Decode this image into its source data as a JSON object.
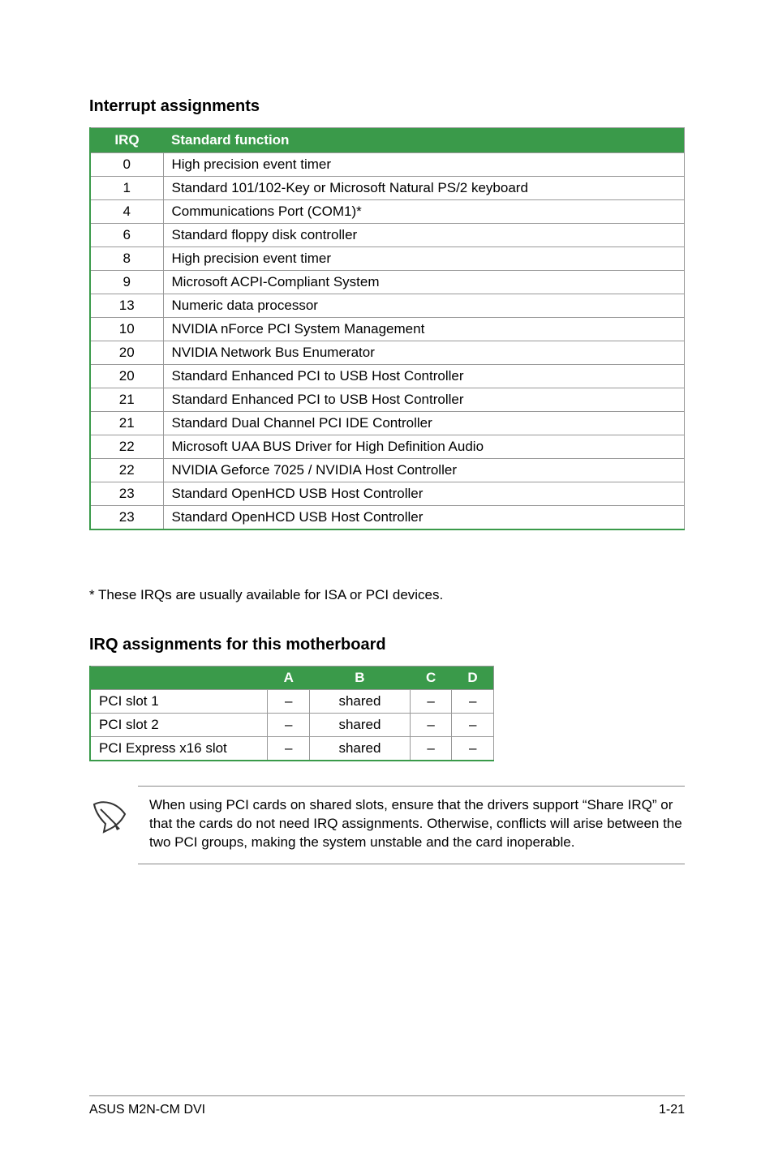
{
  "section1_title": "Interrupt assignments",
  "irq_table": {
    "headers": {
      "irq": "IRQ",
      "func": "Standard function"
    },
    "rows": [
      {
        "irq": "0",
        "func": "High precision event timer"
      },
      {
        "irq": "1",
        "func": "Standard 101/102-Key or Microsoft Natural PS/2 keyboard"
      },
      {
        "irq": "4",
        "func": "Communications Port (COM1)*"
      },
      {
        "irq": "6",
        "func": "Standard floppy disk controller"
      },
      {
        "irq": "8",
        "func": "High precision event timer"
      },
      {
        "irq": "9",
        "func": "Microsoft ACPI-Compliant System"
      },
      {
        "irq": "13",
        "func": "Numeric data processor"
      },
      {
        "irq": "10",
        "func": "NVIDIA nForce PCI System Management"
      },
      {
        "irq": "20",
        "func": "NVIDIA Network Bus Enumerator"
      },
      {
        "irq": "20",
        "func": "Standard Enhanced PCI to USB Host Controller"
      },
      {
        "irq": "21",
        "func": "Standard Enhanced PCI to USB Host Controller"
      },
      {
        "irq": "21",
        "func": "Standard Dual Channel PCI IDE Controller"
      },
      {
        "irq": "22",
        "func": "Microsoft UAA BUS Driver for High Definition Audio"
      },
      {
        "irq": "22",
        "func": "NVIDIA Geforce 7025 / NVIDIA Host Controller"
      },
      {
        "irq": "23",
        "func": "Standard OpenHCD USB Host Controller"
      },
      {
        "irq": "23",
        "func": "Standard OpenHCD USB Host Controller"
      }
    ]
  },
  "footnote": "* These IRQs are usually available for ISA or PCI devices.",
  "section2_title": "IRQ assignments for this motherboard",
  "slot_table": {
    "headers": {
      "name": "",
      "a": "A",
      "b": "B",
      "c": "C",
      "d": "D"
    },
    "rows": [
      {
        "name": "PCI slot 1",
        "a": "–",
        "b": "shared",
        "c": "–",
        "d": "–"
      },
      {
        "name": "PCI slot 2",
        "a": "–",
        "b": "shared",
        "c": "–",
        "d": "–"
      },
      {
        "name": "PCI Express x16 slot",
        "a": "–",
        "b": "shared",
        "c": "–",
        "d": "–"
      }
    ]
  },
  "note_text": "When using PCI cards on shared slots, ensure that the drivers support “Share IRQ” or that the cards do not need IRQ assignments. Otherwise, conflicts will arise between the two PCI groups, making the system unstable and the card inoperable.",
  "footer_left": "ASUS M2N-CM DVI",
  "footer_right": "1-21"
}
